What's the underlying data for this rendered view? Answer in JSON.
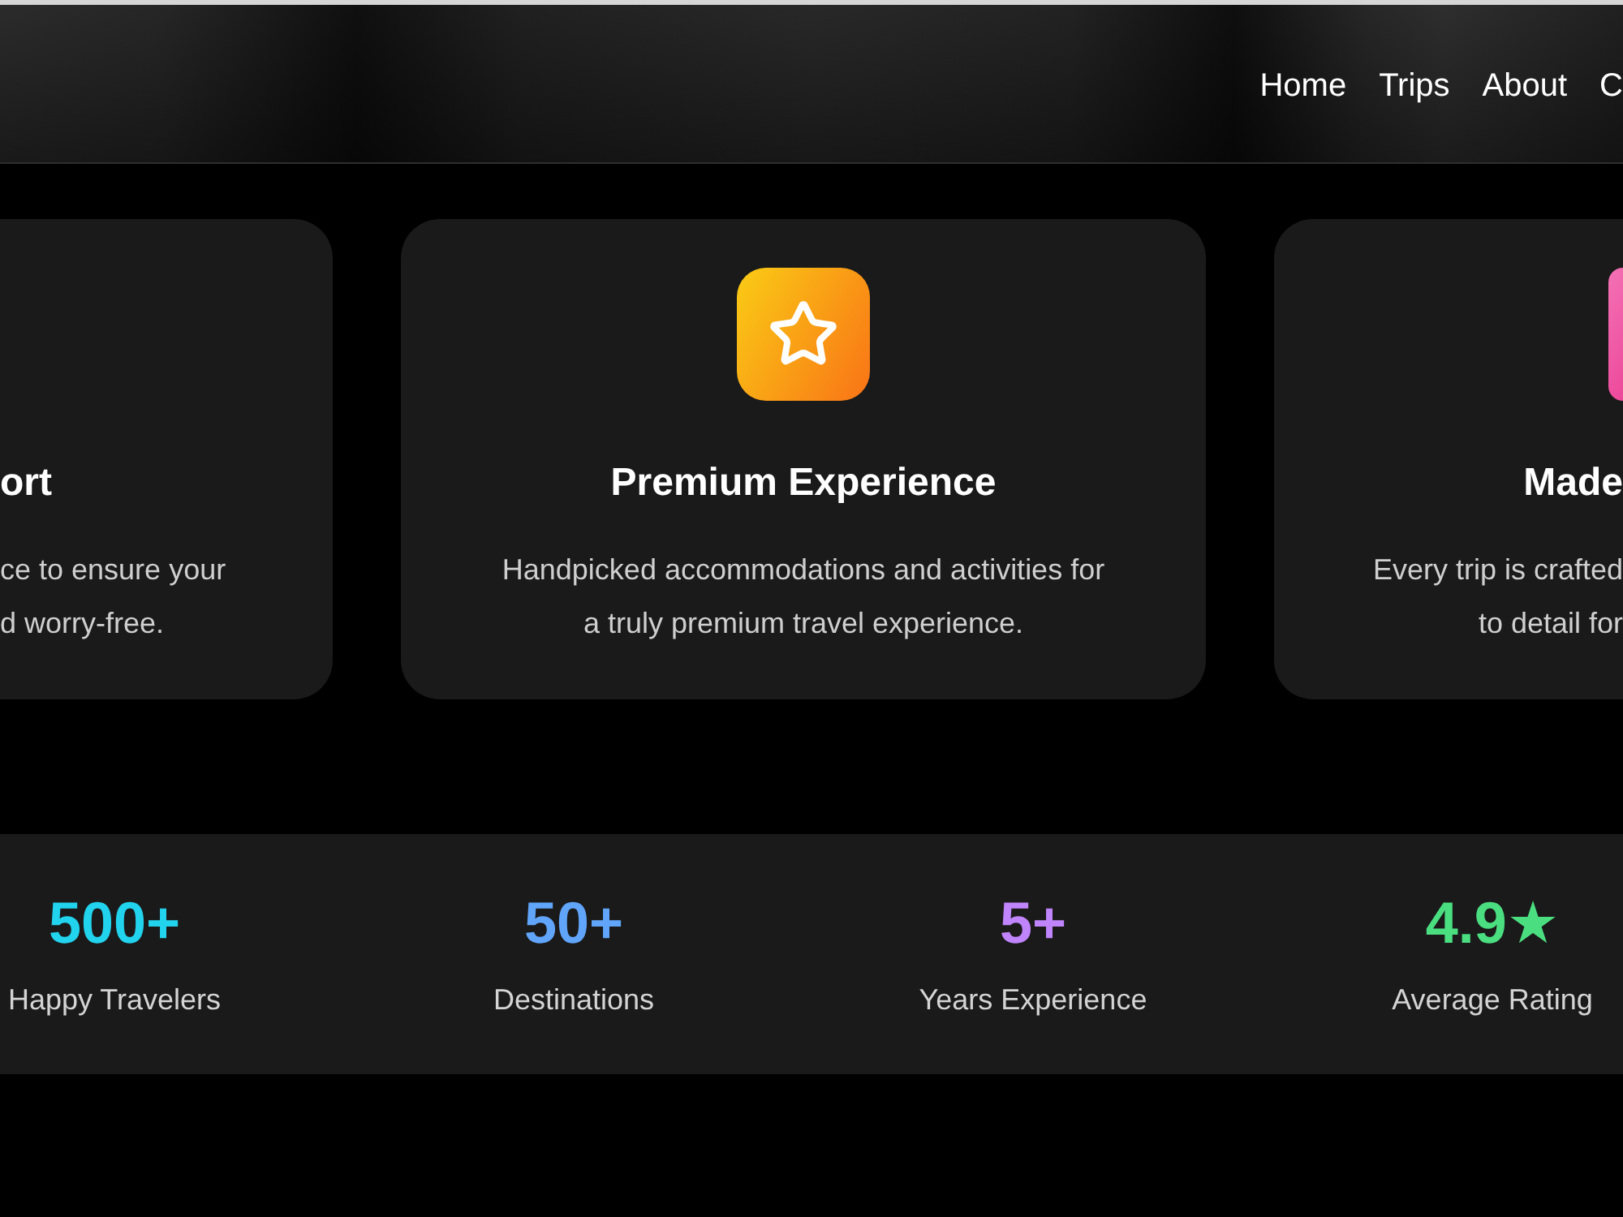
{
  "header": {
    "nav": [
      "Home",
      "Trips",
      "About",
      "C"
    ]
  },
  "features": [
    {
      "kind": "cut_left",
      "title": "ort",
      "description": "ce to ensure your\nd worry-free."
    },
    {
      "kind": "full",
      "title": "Premium Experience",
      "description": "Handpicked accommodations and activities for\na truly premium travel experience."
    },
    {
      "kind": "cut_right",
      "title": "Made",
      "description": "Every trip is crafted\nto detail for"
    }
  ],
  "stats": [
    {
      "value": "500+",
      "label": "Happy Travelers",
      "color": "#22d3ee"
    },
    {
      "value": "50+",
      "label": "Destinations",
      "color": "#60a5fa"
    },
    {
      "value": "5+",
      "label": "Years Experience",
      "color": "#c084fc"
    },
    {
      "value": "4.9★",
      "label": "Average Rating",
      "color": "#4ade80"
    }
  ]
}
